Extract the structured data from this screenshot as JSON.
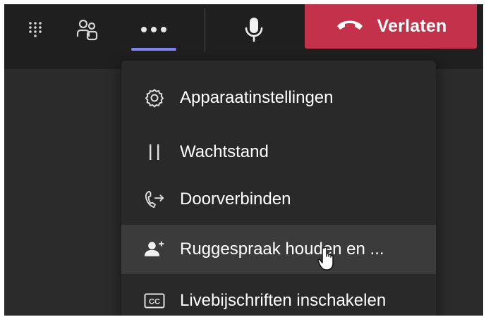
{
  "toolbar": {
    "dialpad_icon": "dialpad-icon",
    "people_icon": "people-icon",
    "more_icon": "more-options-icon",
    "mic_icon": "microphone-icon",
    "leave": {
      "label": "Verlaten",
      "icon": "hang-up-phone-icon",
      "color": "#c4314b"
    },
    "active_indicator_color": "#7f85f5"
  },
  "menu": {
    "items": [
      {
        "label": "Apparaatinstellingen",
        "icon": "gear-icon"
      },
      {
        "label": "Wachtstand",
        "icon": "pause-icon"
      },
      {
        "label": "Doorverbinden",
        "icon": "transfer-call-icon"
      },
      {
        "label": "Ruggespraak houden en ...",
        "icon": "consult-person-add-icon",
        "hovered": true
      },
      {
        "label": "Livebijschriften inschakelen",
        "icon": "closed-captions-icon"
      }
    ]
  },
  "colors": {
    "toolbar_bg": "#1f1f1f",
    "menu_bg": "#292929",
    "hover_bg": "#3b3b3b",
    "stage_bg": "#2b2b2b"
  }
}
